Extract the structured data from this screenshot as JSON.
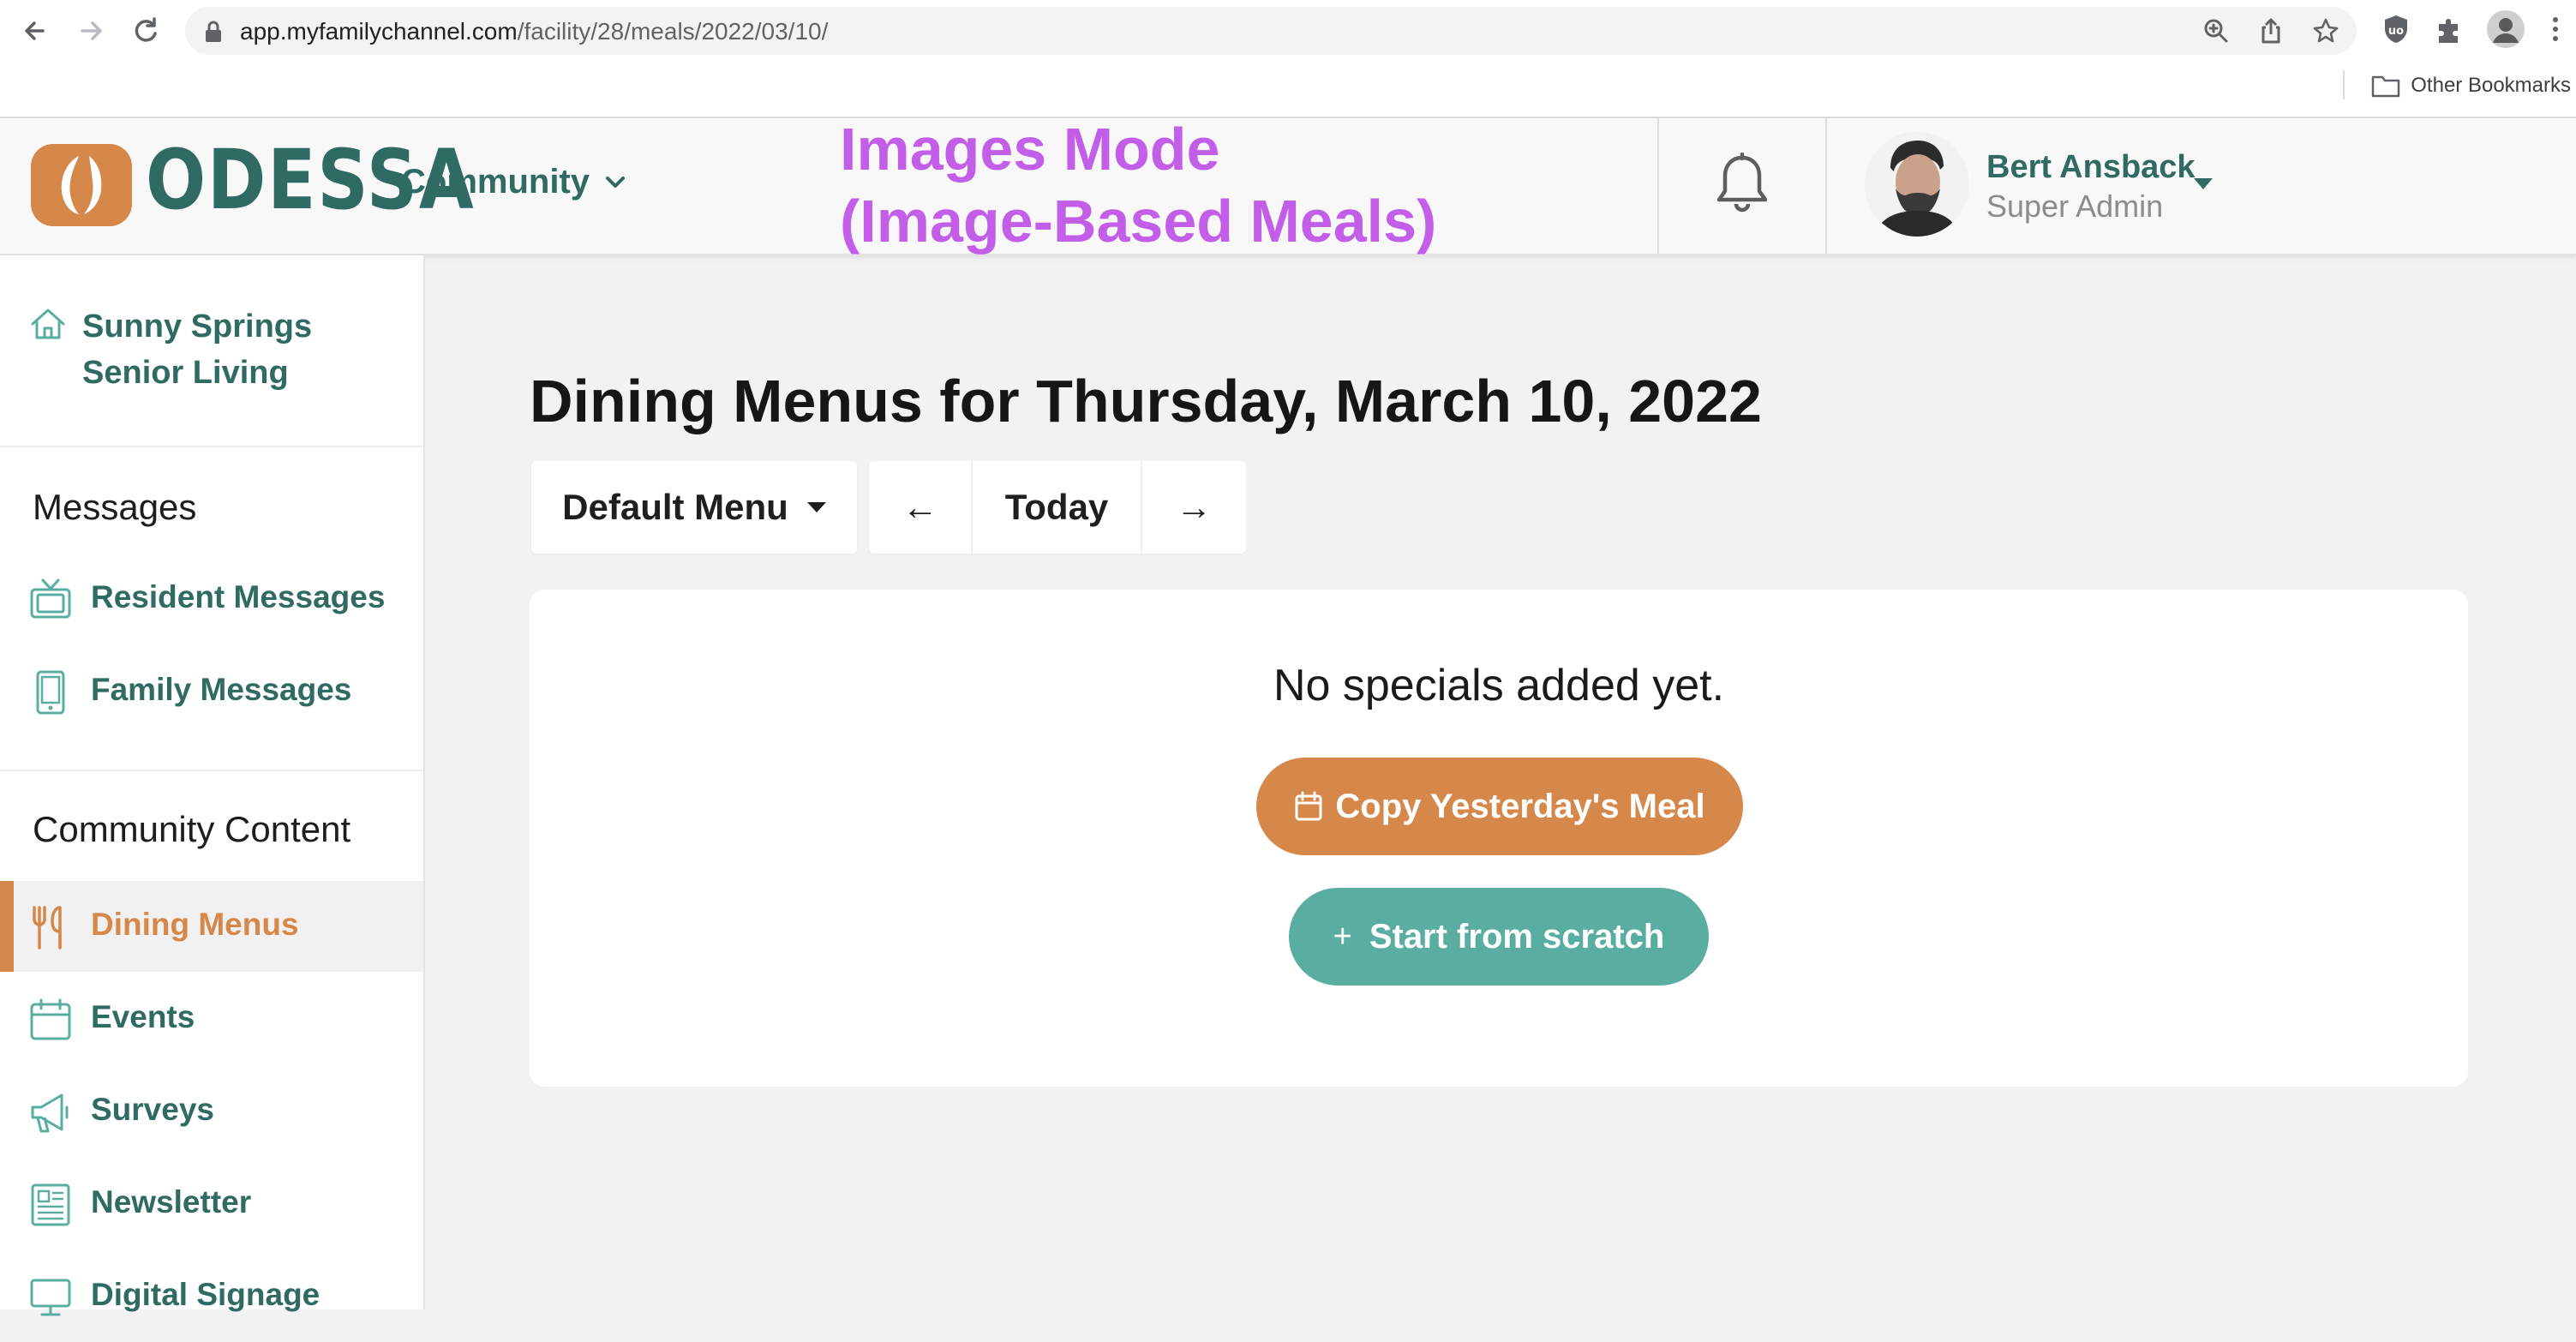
{
  "browser": {
    "url_host": "app.myfamilychannel.com",
    "url_path": "/facility/28/meals/2022/03/10/",
    "bookmarks_label": "Other Bookmarks"
  },
  "header": {
    "brand": "ODESSA",
    "community_label": "Community",
    "annotation": "Images Mode\n(Image-Based Meals)",
    "user_name": "Bert Ansback",
    "user_role": "Super Admin"
  },
  "sidebar": {
    "facility_name": "Sunny Springs Senior Living",
    "messages_title": "Messages",
    "messages_items": [
      {
        "label": "Resident Messages",
        "icon": "tv-icon"
      },
      {
        "label": "Family Messages",
        "icon": "phone-icon"
      }
    ],
    "content_title": "Community Content",
    "content_items": [
      {
        "label": "Dining Menus",
        "icon": "utensils-icon",
        "active": true
      },
      {
        "label": "Events",
        "icon": "calendar-icon"
      },
      {
        "label": "Surveys",
        "icon": "megaphone-icon"
      },
      {
        "label": "Newsletter",
        "icon": "newspaper-icon"
      },
      {
        "label": "Digital Signage",
        "icon": "monitor-icon"
      }
    ]
  },
  "main": {
    "title": "Dining Menus for Thursday, March 10, 2022",
    "menu_select": "Default Menu",
    "prev_label": "←",
    "today_label": "Today",
    "next_label": "→",
    "empty_text": "No specials added yet.",
    "copy_label": "Copy Yesterday's Meal",
    "scratch_label": "Start from scratch",
    "scratch_prefix": "+"
  },
  "colors": {
    "brand_teal": "#2f6a63",
    "accent_orange": "#d6874a",
    "button_teal": "#5aaea1",
    "annotation_purple": "#c35ee9"
  }
}
